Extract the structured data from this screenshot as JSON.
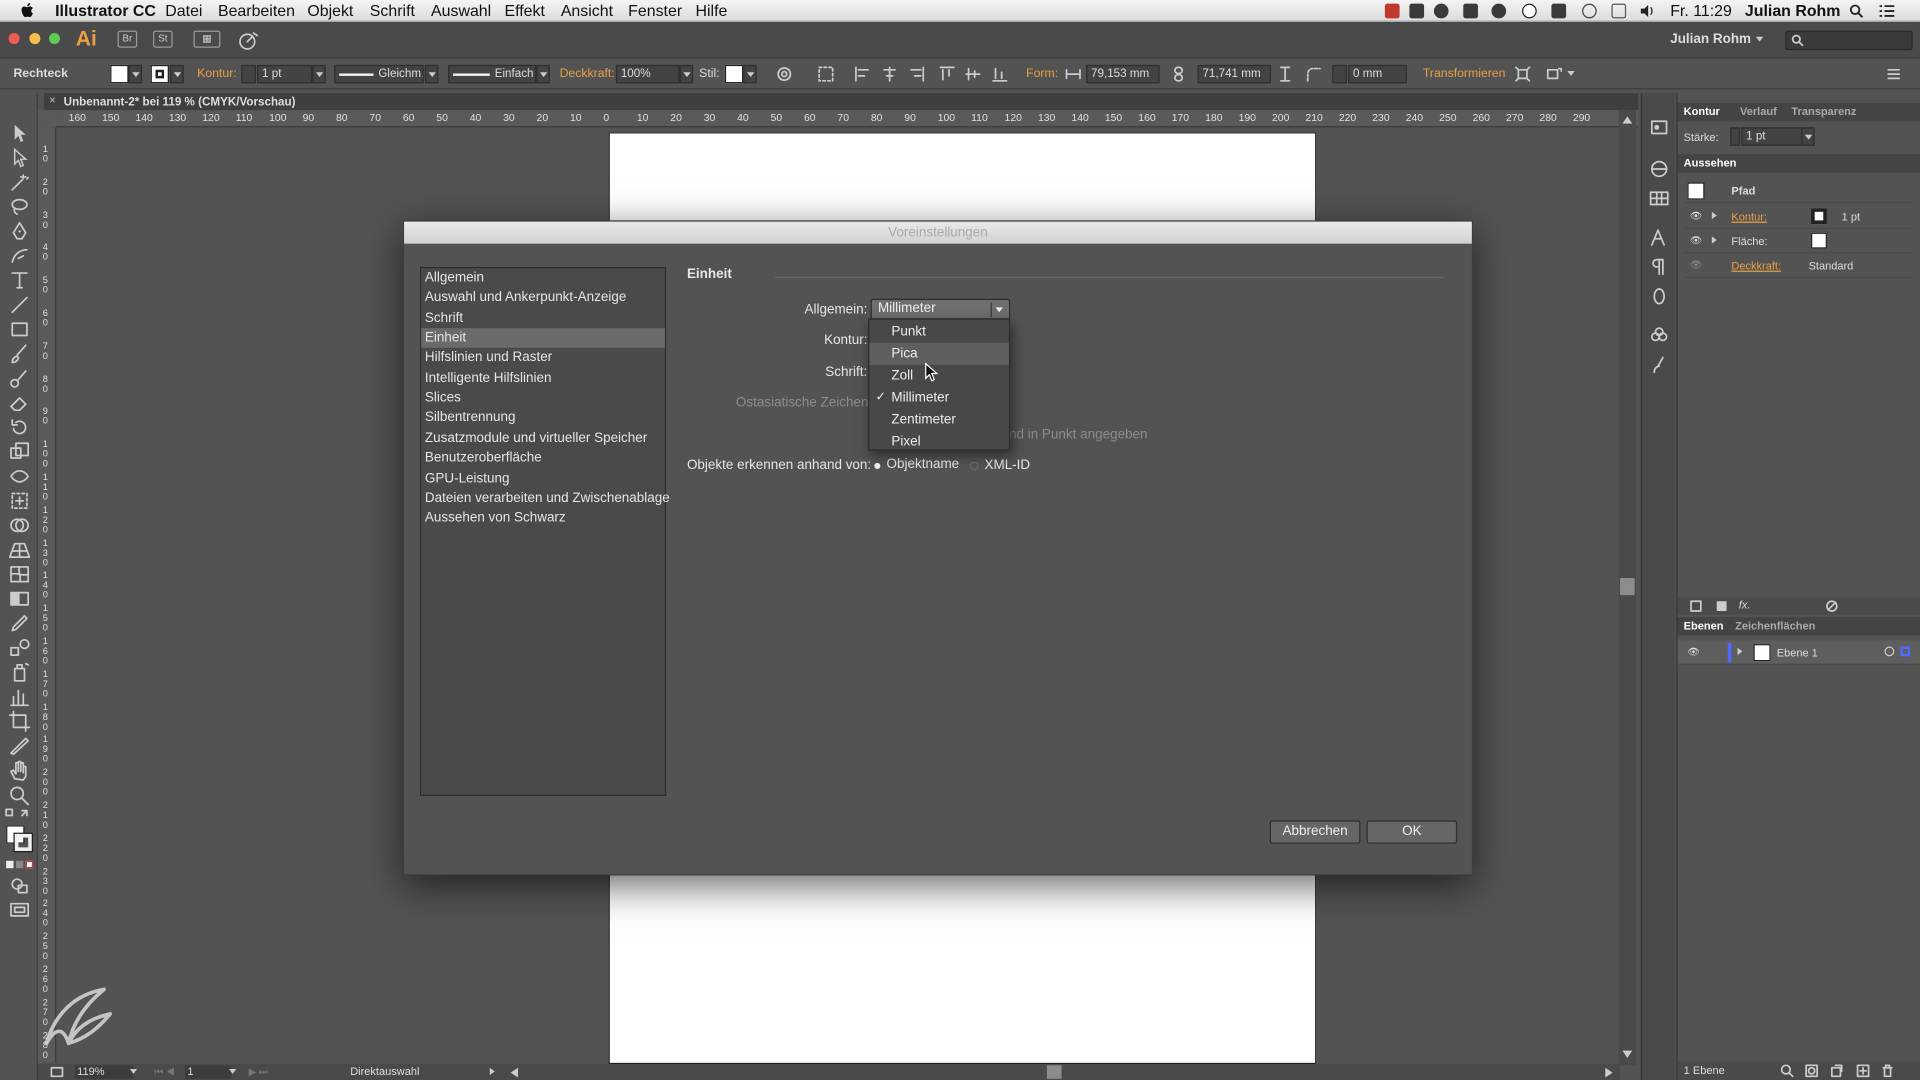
{
  "menubar": {
    "app_name": "Illustrator CC",
    "menus": [
      "Datei",
      "Bearbeiten",
      "Objekt",
      "Schrift",
      "Auswahl",
      "Effekt",
      "Ansicht",
      "Fenster",
      "Hilfe"
    ],
    "clock": "Fr. 11:29",
    "user": "Julian Rohm"
  },
  "appbar": {
    "logo": "Ai",
    "bridge": "Br",
    "stock": "St",
    "user": "Julian Rohm"
  },
  "control_bar": {
    "tool_name": "Rechteck",
    "kontur_label": "Kontur:",
    "stroke_weight": "1 pt",
    "stroke_profile": "Gleichm.",
    "brush": "Einfach",
    "opacity_label": "Deckkraft:",
    "opacity": "100%",
    "style_label": "Stil:",
    "form_label": "Form:",
    "width": "79,153 mm",
    "height": "71,741 mm",
    "corner": "0 mm",
    "transform_label": "Transformieren"
  },
  "document": {
    "tab_title": "Unbenannt-2* bei 119 % (CMYK/Vorschau)",
    "ruler_h": [
      "160",
      "150",
      "140",
      "130",
      "120",
      "110",
      "100",
      "90",
      "80",
      "70",
      "60",
      "50",
      "40",
      "30",
      "20",
      "10",
      "0",
      "10",
      "20",
      "30",
      "40",
      "50",
      "60",
      "70",
      "80",
      "90",
      "100",
      "110",
      "120",
      "130",
      "140",
      "150",
      "160",
      "170",
      "180",
      "190",
      "200",
      "210",
      "220",
      "230",
      "240",
      "250",
      "260",
      "270",
      "280",
      "290"
    ],
    "ruler_v": [
      "1 0",
      "2 0",
      "3 0",
      "4 0",
      "5 0",
      "6 0",
      "7 0",
      "8 0",
      "9 0",
      "1 0 0",
      "1 1 0",
      "1 2 0",
      "1 3 0",
      "1 4 0",
      "1 5 0",
      "1 6 0",
      "1 7 0",
      "1 8 0",
      "1 9 0",
      "2 0 0",
      "2 1 0",
      "2 2 0",
      "2 3 0",
      "2 4 0",
      "2 5 0",
      "2 6 0",
      "2 7 0",
      "2 8 0"
    ]
  },
  "status_bar": {
    "zoom": "119%",
    "page": "1",
    "tool_status": "Direktauswahl"
  },
  "dialog": {
    "title": "Voreinstellungen",
    "categories": [
      {
        "label": "Allgemein",
        "selected": false
      },
      {
        "label": "Auswahl und Ankerpunkt-Anzeige",
        "selected": false
      },
      {
        "label": "Schrift",
        "selected": false
      },
      {
        "label": "Einheit",
        "selected": true
      },
      {
        "label": "Hilfslinien und Raster",
        "selected": false
      },
      {
        "label": "Intelligente Hilfslinien",
        "selected": false
      },
      {
        "label": "Slices",
        "selected": false
      },
      {
        "label": "Silbentrennung",
        "selected": false
      },
      {
        "label": "Zusatzmodule und virtueller Speicher",
        "selected": false
      },
      {
        "label": "Benutzeroberfläche",
        "selected": false
      },
      {
        "label": "GPU-Leistung",
        "selected": false
      },
      {
        "label": "Dateien verarbeiten und Zwischenablage",
        "selected": false
      },
      {
        "label": "Aussehen von Schwarz",
        "selected": false
      }
    ],
    "section_title": "Einheit",
    "allgemein_label": "Allgemein:",
    "allgemein_value": "Millimeter",
    "kontur_label": "Kontur:",
    "schrift_label": "Schrift:",
    "ostasiatisch_label": "Ostasiatische Zeichen:",
    "hint_partial": "nd in Punkt angegeben",
    "objekte_label": "Objekte erkennen anhand von:",
    "radio_objektname": "Objektname",
    "radio_xmlid": "XML-ID",
    "selected_radio": "Objektname",
    "cancel": "Abbrechen",
    "ok": "OK",
    "unit_options": [
      {
        "label": "Punkt",
        "checked": false,
        "hover": false
      },
      {
        "label": "Pica",
        "checked": false,
        "hover": true
      },
      {
        "label": "Zoll",
        "checked": false,
        "hover": false
      },
      {
        "label": "Millimeter",
        "checked": true,
        "hover": false
      },
      {
        "label": "Zentimeter",
        "checked": false,
        "hover": false
      },
      {
        "label": "Pixel",
        "checked": false,
        "hover": false
      }
    ]
  },
  "panels": {
    "stroke_tabs": [
      "Kontur",
      "Verlauf",
      "Transparenz"
    ],
    "starke_label": "Stärke:",
    "starke_value": "1 pt",
    "appearance_title": "Aussehen",
    "appearance_path": "Pfad",
    "appearance_rows": [
      {
        "label": "Kontur:",
        "value": "1 pt"
      },
      {
        "label": "Fläche:",
        "value": ""
      },
      {
        "label": "Deckkraft:",
        "value": "Standard"
      }
    ],
    "layers_tabs": [
      "Ebenen",
      "Zeichenflächen"
    ],
    "layer_name": "Ebene 1",
    "layer_count": "1 Ebene"
  },
  "colors": {
    "accent_orange": "#e8a045",
    "ui_dark": "#535353",
    "selection": "#6a6a6a",
    "layer_color": "#4f6bff"
  }
}
